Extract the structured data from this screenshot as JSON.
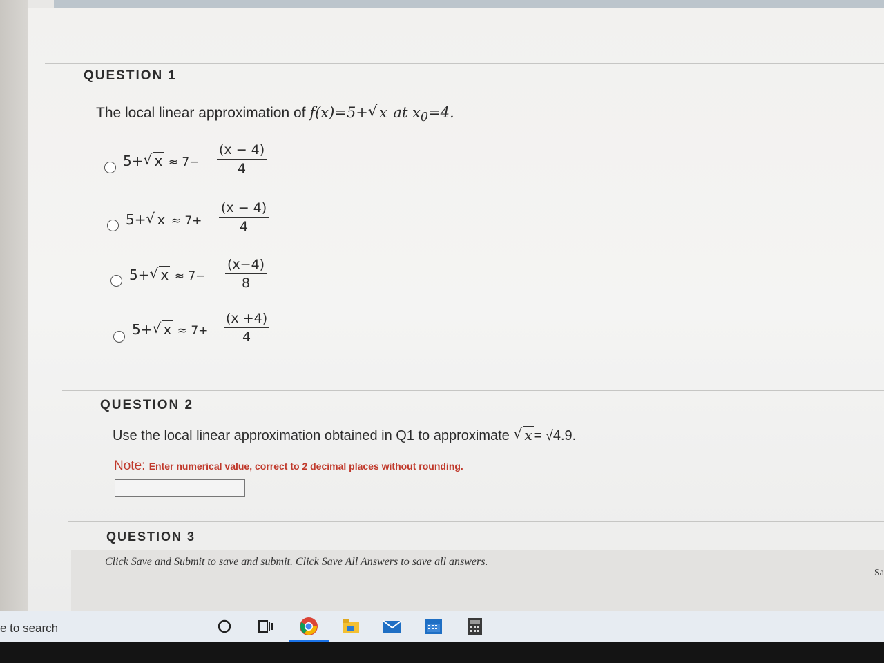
{
  "q1": {
    "title": "QUESTION 1",
    "prompt": "The local linear approximation of ",
    "func": "f(x)=5+",
    "radicand": "x",
    "at": " at x",
    "sub": "0",
    "tail": "=4.",
    "options": [
      {
        "lhs": "5+",
        "rad": "x",
        "op": "≈ 7−",
        "num": "(x − 4)",
        "den": "4"
      },
      {
        "lhs": "5+",
        "rad": "x",
        "op": "≈ 7+",
        "num": "(x − 4)",
        "den": "4"
      },
      {
        "lhs": "5+",
        "rad": "x",
        "op": "≈  7−",
        "num": "(x−4)",
        "den": "8"
      },
      {
        "lhs": "5+",
        "rad": "x",
        "op": "≈ 7+",
        "num": "(x +4)",
        "den": "4"
      }
    ]
  },
  "q2": {
    "title": "QUESTION 2",
    "prompt": "Use the local linear approximation obtained in Q1 to approximate ",
    "rad": "x",
    "tail": "= √4.9.",
    "note_label": "Note: ",
    "note": "Enter numerical value, correct to 2 decimal places without rounding."
  },
  "q3": {
    "title": "QUESTION 3"
  },
  "footer": {
    "text": "Click Save and Submit to save and submit. Click Save All Answers to save all answers.",
    "save_tab": "Sa"
  },
  "taskbar": {
    "search": "e to search",
    "icons": [
      "cortana-icon",
      "task-view-icon",
      "chrome-icon",
      "file-explorer-icon",
      "mail-icon",
      "calendar-icon",
      "calculator-icon"
    ]
  },
  "colors": {
    "note": "#c0392b",
    "accent": "#1a73e8"
  }
}
